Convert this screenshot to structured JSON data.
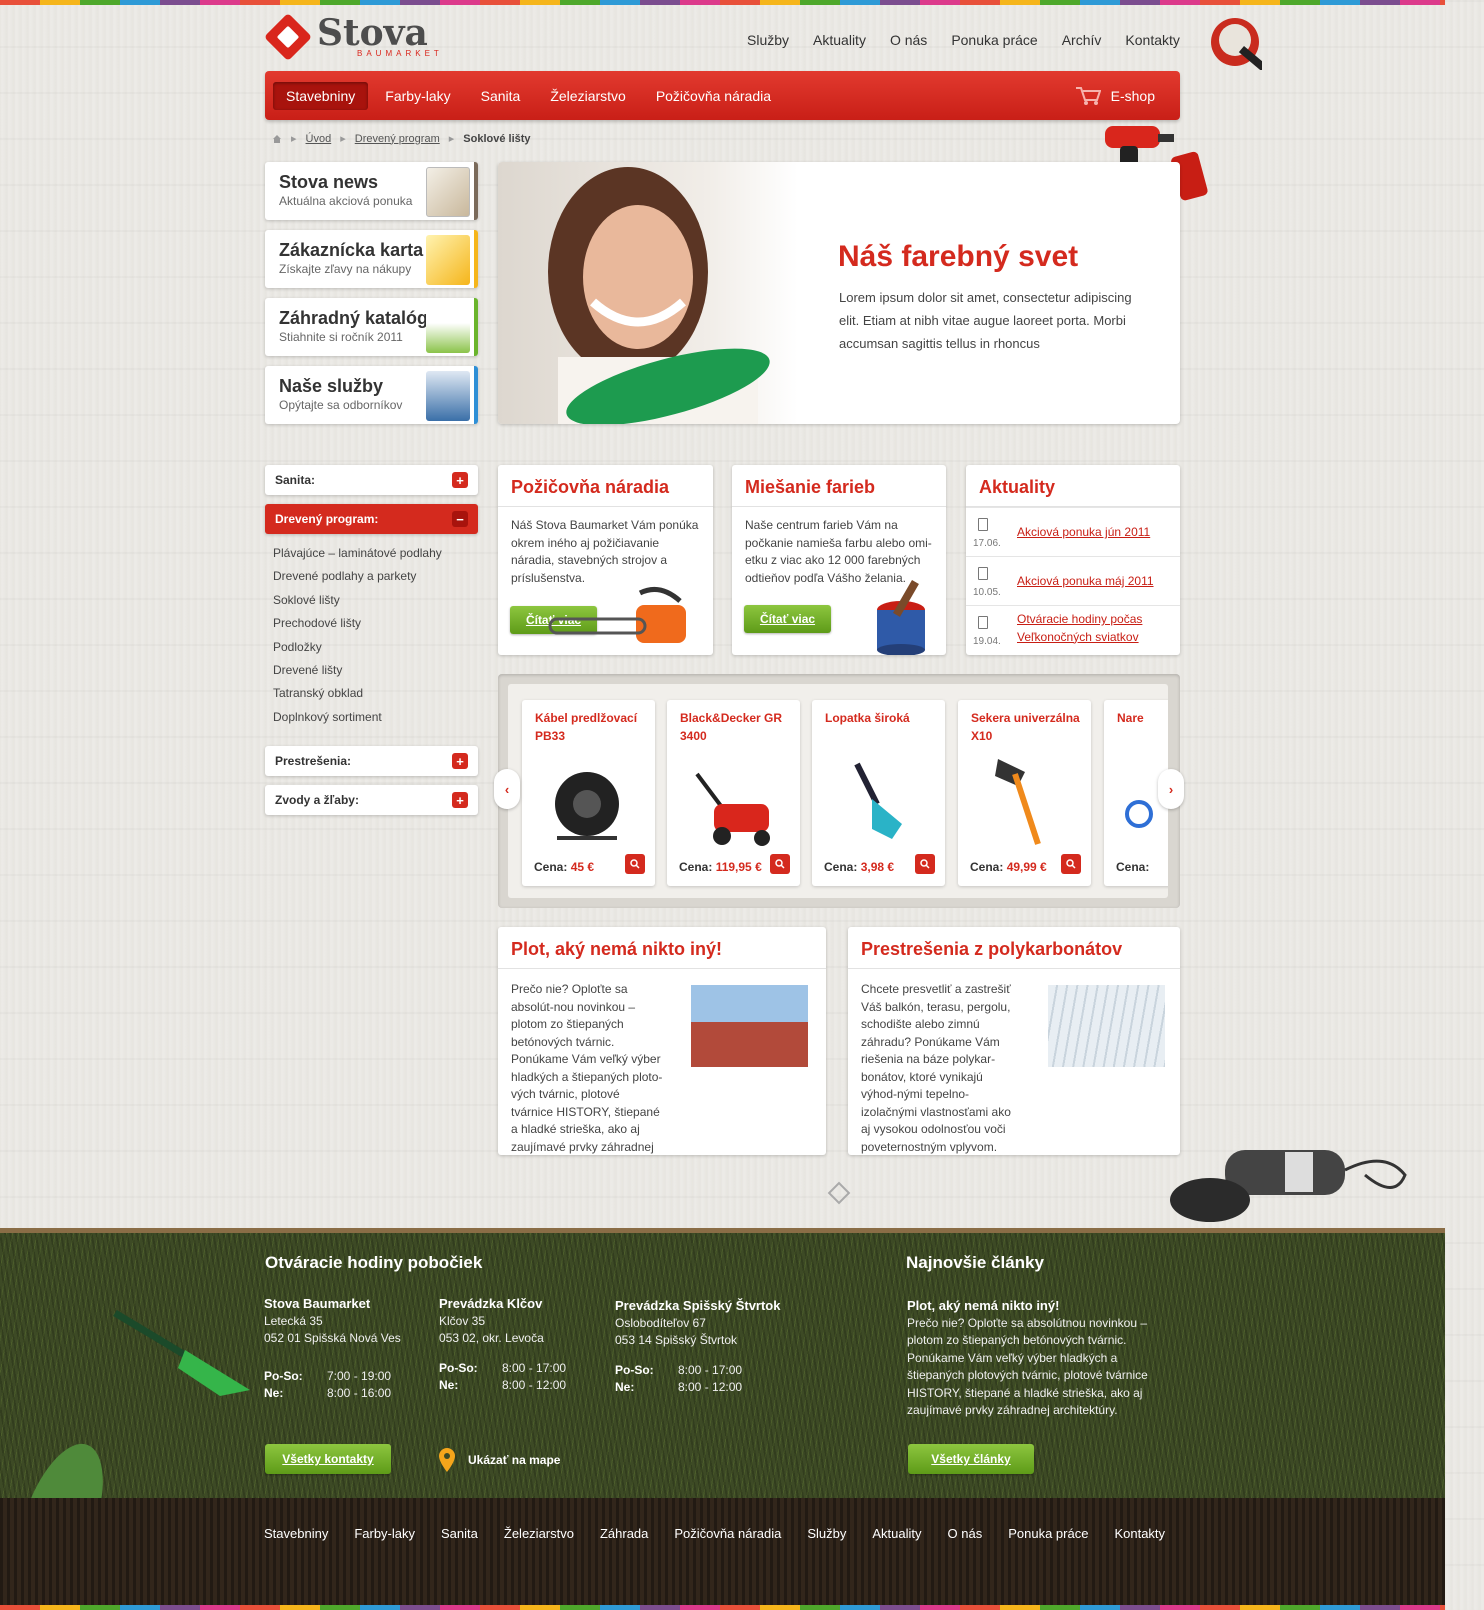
{
  "brand": {
    "name": "Stova",
    "sub": "BAUMARKET"
  },
  "topnav": [
    "Služby",
    "Aktuality",
    "O nás",
    "Ponuka práce",
    "Archív",
    "Kontakty"
  ],
  "mainnav": {
    "items": [
      "Stavebniny",
      "Farby-laky",
      "Sanita",
      "Železiarstvo",
      "Požičovňa náradia"
    ],
    "eshop": "E-shop"
  },
  "breadcrumb": {
    "items": [
      "Úvod",
      "Drevený program"
    ],
    "current": "Soklové lišty"
  },
  "promos": [
    {
      "title": "Stova news",
      "sub": "Aktuálna akciová ponuka",
      "color": "#7a6a5a"
    },
    {
      "title": "Zákaznícka karta",
      "sub": "Získajte zľavy na nákupy",
      "color": "#f5b51b"
    },
    {
      "title": "Záhradný katalóg",
      "sub": "Stiahnite si ročník 2011",
      "color": "#6ab42c"
    },
    {
      "title": "Naše služby",
      "sub": "Opýtajte sa odborníkov",
      "color": "#2e8fd6"
    }
  ],
  "hero": {
    "title": "Náš farebný svet",
    "text": "Lorem ipsum dolor sit amet, consectetur adipiscing elit. Etiam at nibh vitae augue laoreet porta. Morbi accumsan sagittis tellus in rhoncus"
  },
  "sidebar": {
    "sanita": "Sanita:",
    "dreveny": "Drevený program:",
    "sub": [
      "Plávajúce – laminátové podlahy",
      "Drevené podlahy a parkety",
      "Soklové lišty",
      "Prechodové lišty",
      "Podložky",
      "Drevené lišty",
      "Tatranský obklad",
      "Doplnkový sortiment"
    ],
    "prestresenia": "Prestrešenia:",
    "zvody": "Zvody a žľaby:"
  },
  "cards": {
    "rental": {
      "title": "Požičovňa náradia",
      "text": "Náš Stova Baumarket Vám ponúka okrem iného aj požičiavanie náradia, stavebných strojov a príslušenstva.",
      "button": "Čítať viac"
    },
    "mixing": {
      "title": "Miešanie farieb",
      "text": "Naše centrum farieb Vám na počkanie namieša farbu alebo omi-etku z viac ako 12 000 farebných odtieňov podľa Vášho želania.",
      "button": "Čítať viac"
    },
    "news": {
      "title": "Aktuality",
      "items": [
        {
          "date": "17.06.",
          "label": "Akciová ponuka jún 2011"
        },
        {
          "date": "10.05.",
          "label": "Akciová ponuka máj 2011"
        },
        {
          "date": "19.04.",
          "label": "Otváracie hodiny počas Veľkonočných sviatkov"
        }
      ]
    }
  },
  "products": [
    {
      "name": "Kábel predlžovací PB33",
      "price_label": "Cena:",
      "price": "45 €"
    },
    {
      "name": "Black&Decker GR 3400",
      "price_label": "Cena:",
      "price": "119,95 €"
    },
    {
      "name": "Lopatka široká",
      "price_label": "Cena:",
      "price": "3,98 €"
    },
    {
      "name": "Sekera univerzálna X10",
      "price_label": "Cena:",
      "price": "49,99 €"
    },
    {
      "name": "Nare",
      "price_label": "Cena:",
      "price": ""
    }
  ],
  "articles": {
    "fence": {
      "title": "Plot, aký nemá nikto iný!",
      "text": "Prečo nie? Oploťte sa absolút-nou novinkou – plotom zo štiepaných betónových tvárnic. Ponúkame Vám veľký výber hladkých a štiepaných ploto-vých tvárnic, plotové tvárnice HISTORY, štiepané a hladké strieška, ako aj zaujímavé prvky záhradnej architektúry."
    },
    "roof": {
      "title": "Prestrešenia z polykarbonátov",
      "text": "Chcete presvetliť a zastrešiť Váš balkón, terasu, pergolu, schodište alebo zimnú záhradu? Ponúkame Vám riešenia na báze polykar-bonátov, ktoré vynikajú výhod-nými tepelno-izolačnými vlastnosťami ako aj vysokou odolnosťou voči poveternostným vplyvom."
    }
  },
  "footer": {
    "hours_title": "Otváracie hodiny pobočiek",
    "branches": [
      {
        "name": "Stova Baumarket",
        "addr1": "Letecká 35",
        "addr2": "052 01 Spišská Nová Ves",
        "d1": "Po-So:",
        "h1": "7:00 - 19:00",
        "d2": "Ne:",
        "h2": "8:00 - 16:00"
      },
      {
        "name": "Prevádzka Klčov",
        "addr1": "Klčov 35",
        "addr2": "053 02, okr. Levoča",
        "d1": "Po-So:",
        "h1": "8:00 - 17:00",
        "d2": "Ne:",
        "h2": "8:00 - 12:00"
      },
      {
        "name": "Prevádzka Spišský Štvrtok",
        "addr1": "Oslobodíteľov 67",
        "addr2": "053 14 Spišský Štvrtok",
        "d1": "Po-So:",
        "h1": "8:00 - 17:00",
        "d2": "Ne:",
        "h2": "8:00 - 12:00"
      }
    ],
    "contacts_btn": "Všetky kontakty",
    "map_link": "Ukázať na mape",
    "articles_title": "Najnovšie články",
    "article_title": "Plot, aký nemá nikto iný!",
    "article_text": "Prečo nie? Oploťte sa absolútnou novinkou – plotom zo štiepaných betónových tvárnic. Ponúkame Vám veľký výber hladkých a štiepaných plotových tvárnic, plotové tvárnice HISTORY, štiepané a hladké strieška, ako aj zaujímavé prvky záhradnej architektúry.",
    "articles_btn": "Všetky články"
  },
  "bottomnav": [
    "Stavebniny",
    "Farby-laky",
    "Sanita",
    "Železiarstvo",
    "Záhrada",
    "Požičovňa náradia",
    "Služby",
    "Aktuality",
    "O nás",
    "Ponuka práce",
    "Kontakty"
  ]
}
